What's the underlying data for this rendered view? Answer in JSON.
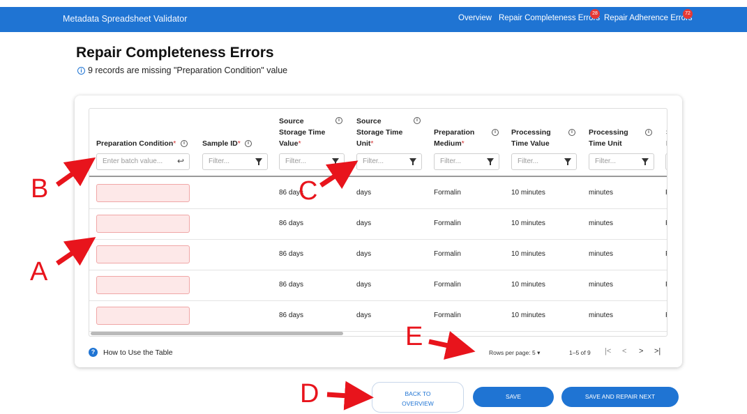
{
  "app": {
    "title": "Metadata Spreadsheet Validator",
    "nav": {
      "overview": "Overview",
      "repair_completeness": "Repair Completeness Errors",
      "repair_completeness_count": "28",
      "repair_adherence": "Repair Adherence Errors",
      "repair_adherence_count": "72"
    }
  },
  "page": {
    "title": "Repair Completeness Errors",
    "subtitle": "9 records are missing \"Preparation Condition\" value",
    "info_icon": "info-icon"
  },
  "table": {
    "columns": [
      {
        "line1": "Preparation Condition",
        "required_mark": "*",
        "placeholder": "Enter batch value..."
      },
      {
        "line1": "Sample ID",
        "required_mark": "*",
        "placeholder": "Filter..."
      },
      {
        "line1": "Source",
        "line2": "Storage Time",
        "line3": "Value",
        "required_mark": "*",
        "placeholder": "Filter..."
      },
      {
        "line1": "Source",
        "line2": "Storage Time",
        "line3": "Unit",
        "required_mark": "*",
        "placeholder": "Filter..."
      },
      {
        "line1": "Preparation",
        "line2": "Medium",
        "required_mark": "*",
        "placeholder": "Filter..."
      },
      {
        "line1": "Processing",
        "line2": "Time Value",
        "placeholder": "Filter..."
      },
      {
        "line1": "Processing",
        "line2": "Time Unit",
        "placeholder": "Filter..."
      },
      {
        "line1": "St",
        "line2": "M"
      }
    ],
    "rows": [
      {
        "storage_value": "86 days",
        "storage_unit": "days",
        "medium": "Formalin",
        "proc_value": "10 minutes",
        "proc_unit": "minutes",
        "next": "Pa"
      },
      {
        "storage_value": "86 days",
        "storage_unit": "days",
        "medium": "Formalin",
        "proc_value": "10 minutes",
        "proc_unit": "minutes",
        "next": "Pa"
      },
      {
        "storage_value": "86 days",
        "storage_unit": "days",
        "medium": "Formalin",
        "proc_value": "10 minutes",
        "proc_unit": "minutes",
        "next": "Pa"
      },
      {
        "storage_value": "86 days",
        "storage_unit": "days",
        "medium": "Formalin",
        "proc_value": "10 minutes",
        "proc_unit": "minutes",
        "next": "Pa"
      },
      {
        "storage_value": "86 days",
        "storage_unit": "days",
        "medium": "Formalin",
        "proc_value": "10 minutes",
        "proc_unit": "minutes",
        "next": "Pa"
      }
    ]
  },
  "footer": {
    "help": "How to Use the Table",
    "rows_per_page_label": "Rows per page:",
    "rows_per_page_value": "5",
    "range": "1–5 of 9",
    "first": "|<",
    "prev": "<",
    "next": ">",
    "last": ">|"
  },
  "actions": {
    "back_line1": "BACK TO",
    "back_line2": "OVERVIEW",
    "save": "SAVE",
    "save_next": "SAVE AND REPAIR NEXT"
  },
  "annotations": {
    "a": "A",
    "b": "B",
    "c": "C",
    "d": "D",
    "e": "E",
    "color": "#e8141c"
  }
}
